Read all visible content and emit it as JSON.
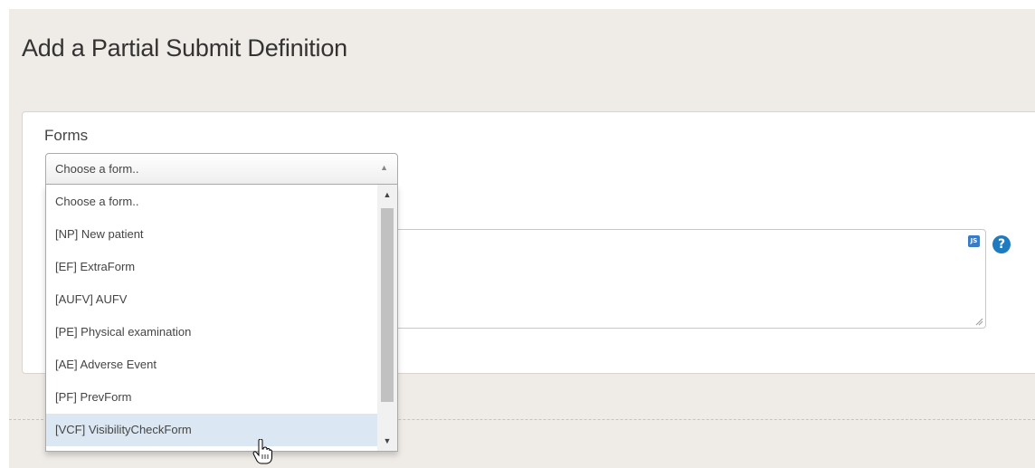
{
  "page": {
    "title": "Add a Partial Submit Definition"
  },
  "forms_field": {
    "label": "Forms",
    "selected_value": "Choose a form..",
    "options": [
      "Choose a form..",
      "[NP] New patient",
      "[EF] ExtraForm",
      "[AUFV] AUFV",
      "[PE] Physical examination",
      "[AE] Adverse Event",
      "[PF] PrevForm",
      "[VCF] VisibilityCheckForm"
    ],
    "highlighted_option": "[VCF] VisibilityCheckForm"
  },
  "icons": {
    "select_arrow": "triangle-up-icon",
    "script_badge": "js-icon",
    "help": "question-mark-icon",
    "cursor": "hand-pointer-icon",
    "resize": "resize-handle-icon"
  },
  "glyphs": {
    "select_arrow": "▲",
    "scroll_up": "▲",
    "scroll_down": "▼",
    "js": "JS",
    "help": "?"
  },
  "colors": {
    "page_background": "#efebe7",
    "highlight": "#dbe8f4",
    "help_icon": "#1e7bbf",
    "js_icon": "#3a7cc4"
  }
}
